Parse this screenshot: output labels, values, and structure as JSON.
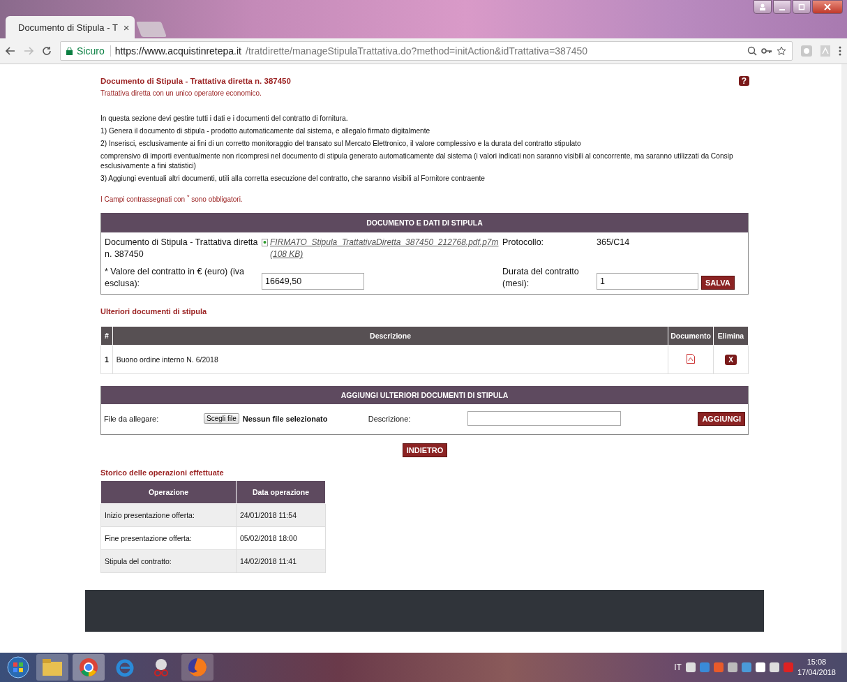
{
  "browser": {
    "tab_title": "Documento di Stipula - T",
    "tab_close": "×",
    "security": "Sicuro",
    "url_host": "https://www.acquistinretepa.it",
    "url_path": "/tratdirette/manageStipulaTrattativa.do?method=initAction&idTrattativa=387450"
  },
  "page": {
    "title": "Documento di Stipula - Trattativa diretta n. 387450",
    "help": "?",
    "subtitle": "Trattativa diretta con un unico operatore economico.",
    "intro": [
      "In questa sezione devi gestire tutti i dati e i documenti del contratto di fornitura.",
      "1) Genera il documento di stipula - prodotto automaticamente dal sistema, e allegalo firmato digitalmente",
      "2) Inserisci, esclusivamente ai fini di un corretto monitoraggio del transato sul Mercato Elettronico, il valore complessivo e la durata del contratto stipulato",
      "comprensivo di importi eventualmente non ricompresi nel documento di stipula generato automaticamente dal sistema (i valori indicati non saranno visibili al concorrente, ma saranno utilizzati da Consip esclusivamente a fini statistici)",
      "3) Aggiungi eventuali altri documenti, utili alla corretta esecuzione del contratto, che saranno visibili al Fornitore contraente"
    ],
    "required_note": "I Campi contrassegnati con $^{*}$ sono obbligatori."
  },
  "stipula": {
    "header": "DOCUMENTO E DATI DI STIPULA",
    "doc_label": "Documento di Stipula - Trattativa diretta n. 387450",
    "file_link": "FIRMATO_Stipula_TrattativaDiretta_387450_212768.pdf.p7m",
    "file_size": "(108 KB)",
    "protocollo_label": "Protocollo:",
    "protocollo_value": "365/C14",
    "valore_label": "* Valore del contratto in € (euro) (iva esclusa):",
    "valore_value": "16649,50",
    "durata_label": "Durata del contratto (mesi):",
    "durata_value": "1",
    "save_button": "SALVA"
  },
  "further_docs": {
    "title": "Ulteriori documenti di stipula",
    "columns": [
      "#",
      "Descrizione",
      "Documento",
      "Elimina"
    ],
    "rows": [
      {
        "number": "1",
        "description": "Buono ordine interno N. 6/2018",
        "delete": "X"
      }
    ]
  },
  "add_doc": {
    "header": "AGGIUNGI ULTERIORI DOCUMENTI DI STIPULA",
    "file_label": "File da allegare:",
    "choose_button": "Scegli file",
    "no_file": "Nessun file selezionato",
    "description_label": "Descrizione:",
    "add_button": "AGGIUNGI"
  },
  "back_button": "INDIETRO",
  "history": {
    "title": "Storico delle operazioni effettuate",
    "columns": [
      "Operazione",
      "Data operazione"
    ],
    "rows": [
      {
        "operation": "Inizio presentazione offerta:",
        "date": "24/01/2018 11:54"
      },
      {
        "operation": "Fine presentazione offerta:",
        "date": "05/02/2018 18:00"
      },
      {
        "operation": "Stipula del contratto:",
        "date": "14/02/2018 11:41"
      }
    ]
  },
  "taskbar": {
    "language": "IT",
    "time": "15:08",
    "date": "17/04/2018"
  }
}
